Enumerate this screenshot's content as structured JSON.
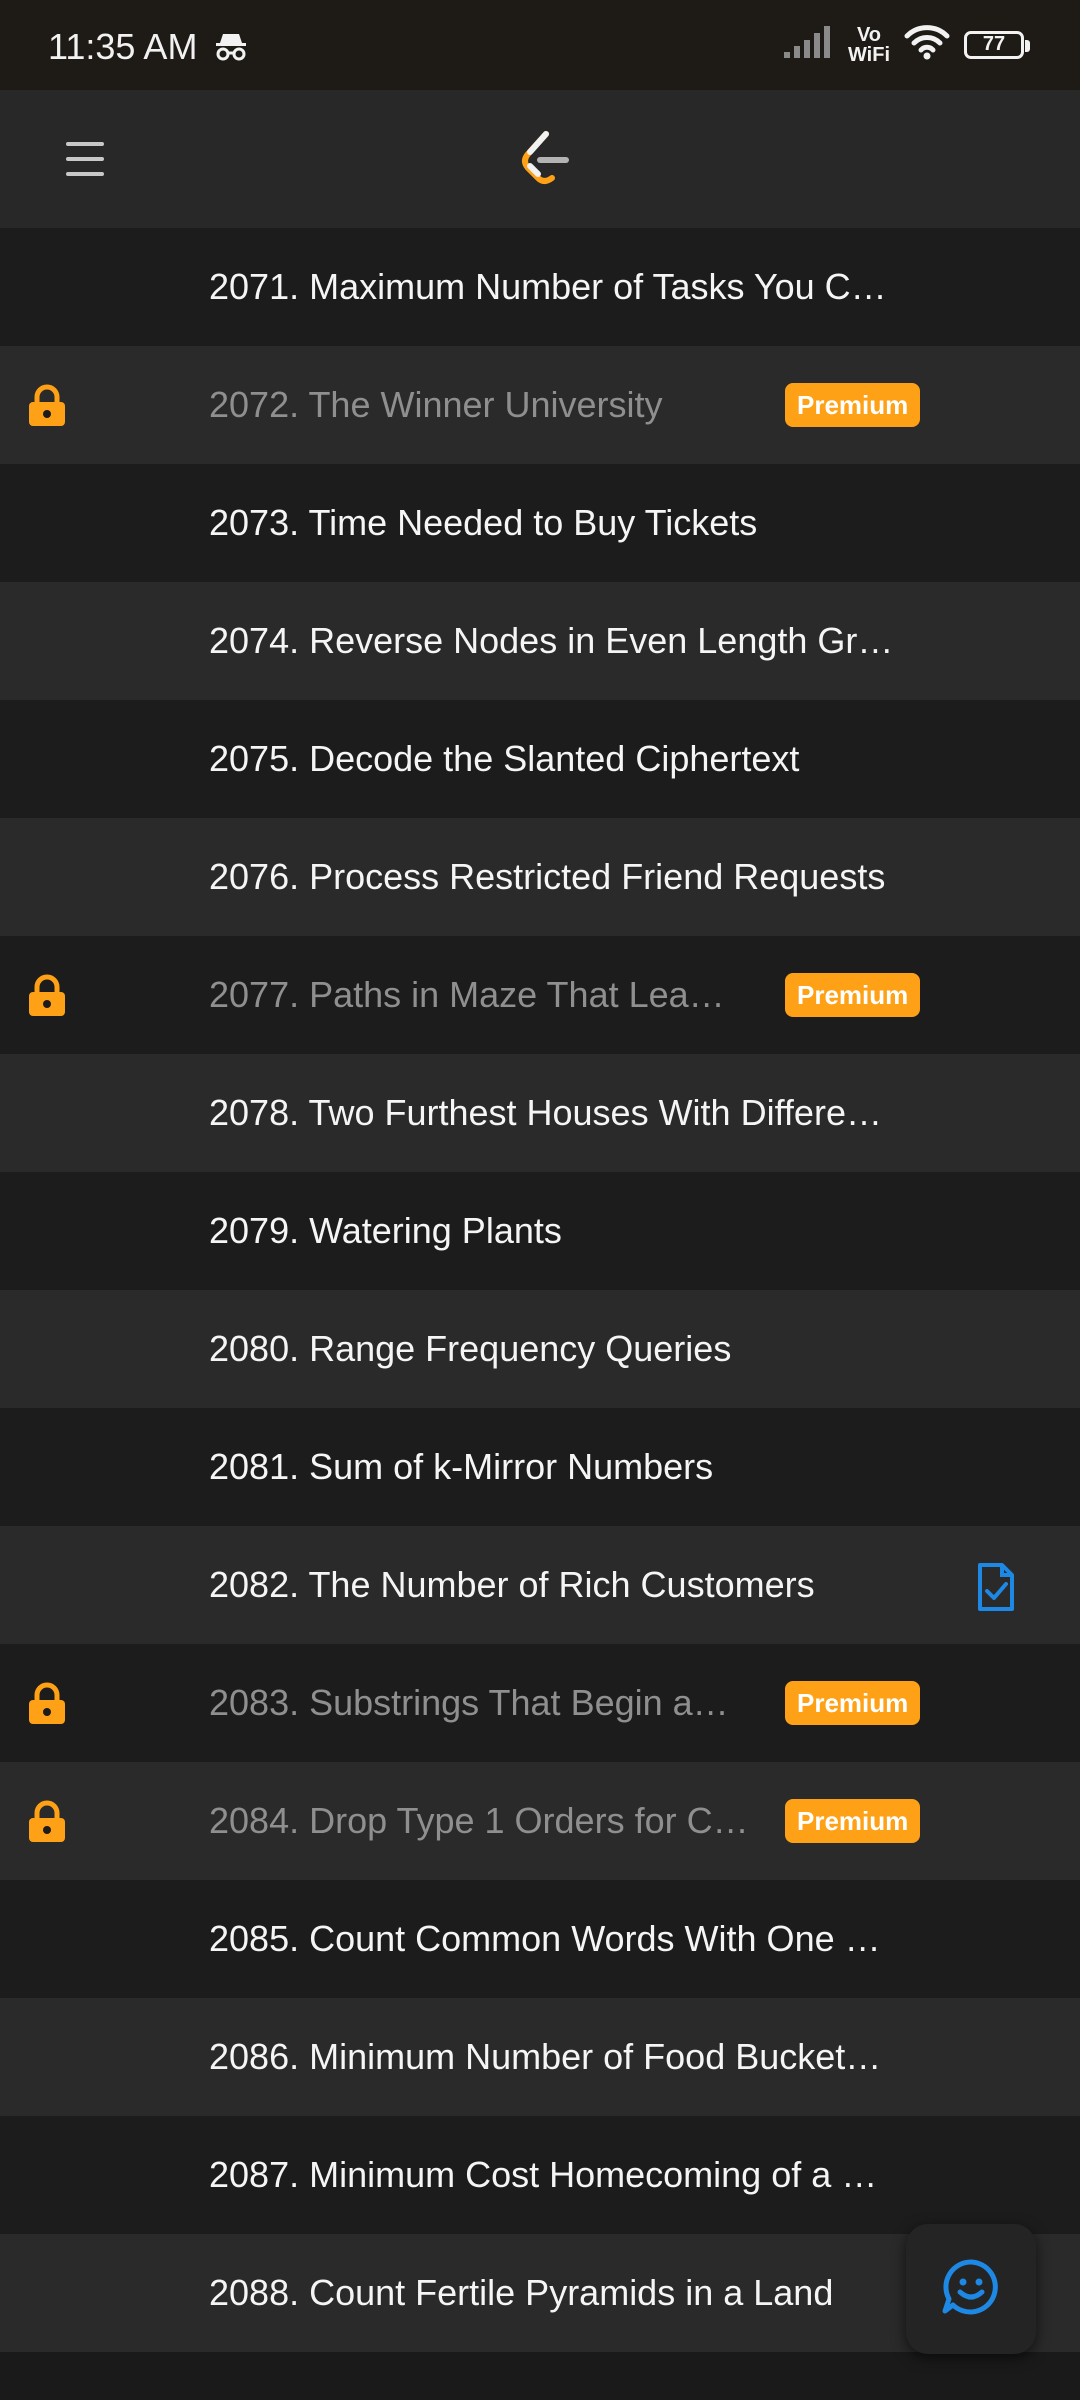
{
  "status_bar": {
    "time": "11:35 AM",
    "network": "Vo WiFi",
    "vo": "Vo",
    "wifi": "WiFi",
    "battery": "77"
  },
  "header": {
    "menu_icon": "hamburger-menu-icon",
    "logo_icon": "leetcode-logo-icon"
  },
  "colors": {
    "accent": "#ffa116",
    "premium_badge": "#ffa116",
    "lock": "#ffa116",
    "solution_icon": "#1e88e5",
    "row_dark": "#1c1c1c",
    "row_light": "#2a2a2a"
  },
  "problems": [
    {
      "title": "2071. Maximum Number of Tasks You C…",
      "locked": false
    },
    {
      "title": "2072. The Winner University",
      "locked": true,
      "badge": "Premium"
    },
    {
      "title": "2073. Time Needed to Buy Tickets",
      "locked": false
    },
    {
      "title": "2074. Reverse Nodes in Even Length Gr…",
      "locked": false
    },
    {
      "title": "2075. Decode the Slanted Ciphertext",
      "locked": false
    },
    {
      "title": "2076. Process Restricted Friend Requests",
      "locked": false
    },
    {
      "title": "2077. Paths in Maze That Lea…",
      "locked": true,
      "badge": "Premium"
    },
    {
      "title": "2078. Two Furthest Houses With Differe…",
      "locked": false
    },
    {
      "title": "2079. Watering Plants",
      "locked": false
    },
    {
      "title": "2080. Range Frequency Queries",
      "locked": false
    },
    {
      "title": "2081. Sum of k-Mirror Numbers",
      "locked": false
    },
    {
      "title": "2082. The Number of Rich Customers",
      "locked": false,
      "solution_icon": "solution-document-icon"
    },
    {
      "title": "2083. Substrings That Begin a…",
      "locked": true,
      "badge": "Premium"
    },
    {
      "title": "2084. Drop Type 1 Orders for C…",
      "locked": true,
      "badge": "Premium"
    },
    {
      "title": "2085. Count Common Words With One …",
      "locked": false
    },
    {
      "title": "2086. Minimum Number of Food Bucket…",
      "locked": false
    },
    {
      "title": "2087. Minimum Cost Homecoming of a …",
      "locked": false
    },
    {
      "title": "2088. Count Fertile Pyramids in a Land",
      "locked": false
    }
  ],
  "fab": {
    "icon": "feedback-smiley-icon"
  }
}
